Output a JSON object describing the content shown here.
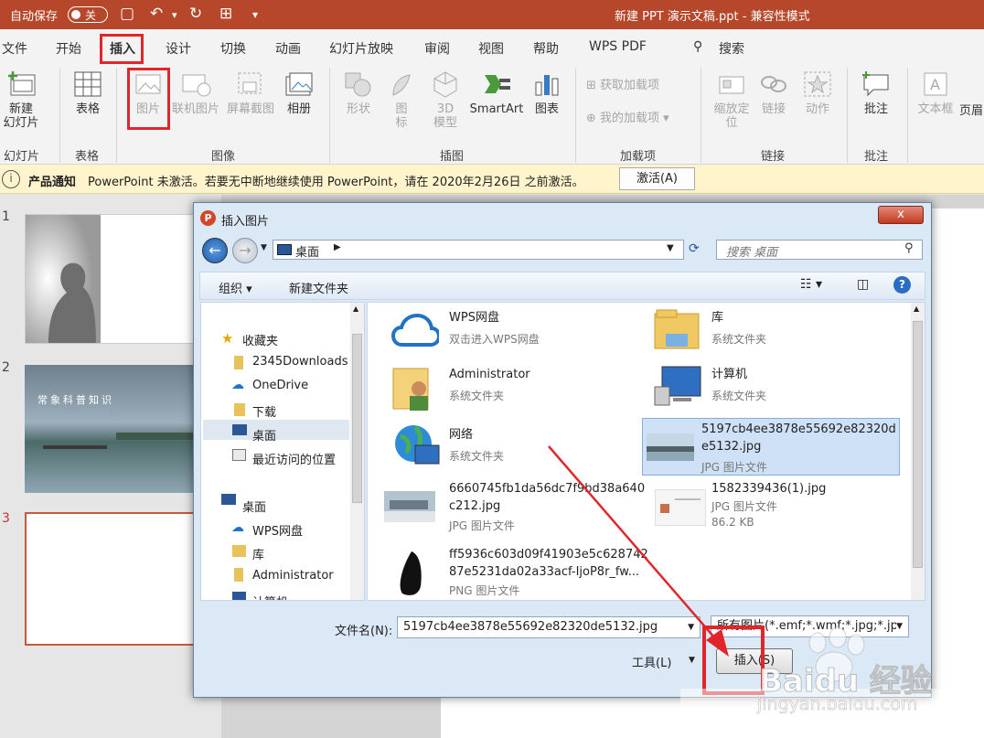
{
  "titlebar": {
    "autosave": "自动保存",
    "toggle": "关",
    "doc_title": "新建 PPT 演示文稿.ppt  -  兼容性模式"
  },
  "tabs": [
    "文件",
    "开始",
    "插入",
    "设计",
    "切换",
    "动画",
    "幻灯片放映",
    "审阅",
    "视图",
    "帮助",
    "WPS PDF",
    "搜索"
  ],
  "ribbon": {
    "new_slide": "新建\n幻灯片",
    "table": "表格",
    "picture": "图片",
    "online_picture": "联机图片",
    "screenshot": "屏幕截图",
    "album": "相册",
    "shapes": "形状",
    "icons": "图\n标",
    "model3d": "3D\n模型",
    "smartart": "SmartArt",
    "chart": "图表",
    "get_addins": "获取加载项",
    "my_addins": "我的加载项",
    "zoom": "缩放定\n位",
    "link": "链接",
    "action": "动作",
    "comment": "批注",
    "textbox": "文本框",
    "header": "页眉",
    "groups": {
      "slides": "幻灯片",
      "tables": "表格",
      "images": "图像",
      "illustrations": "插图",
      "addins": "加载项",
      "links": "链接",
      "comments": "批注"
    }
  },
  "notification": {
    "title": "产品通知",
    "message": "PowerPoint 未激活。若要无中断地继续使用 PowerPoint，请在 2020年2月26日 之前激活。",
    "button": "激活(A)"
  },
  "slides": [
    "1",
    "2",
    "3"
  ],
  "slide2_caption": "常象科普知识",
  "dialog": {
    "title": "插入图片",
    "close": "x",
    "address": "桌面",
    "search_placeholder": "搜索 桌面",
    "organize": "组织 ▾",
    "new_folder": "新建文件夹",
    "nav": {
      "favorites": "收藏夹",
      "items": [
        "2345Downloads",
        "OneDrive",
        "下载",
        "桌面",
        "最近访问的位置"
      ],
      "desktop": "桌面",
      "desktop_items": [
        "WPS网盘",
        "库",
        "Administrator",
        "计算机"
      ]
    },
    "files": [
      {
        "name": "WPS网盘",
        "type": "双击进入WPS网盘"
      },
      {
        "name": "库",
        "type": "系统文件夹"
      },
      {
        "name": "Administrator",
        "type": "系统文件夹"
      },
      {
        "name": "计算机",
        "type": "系统文件夹"
      },
      {
        "name": "网络",
        "type": "系统文件夹"
      },
      {
        "name": "5197cb4ee3878e55692e82320d\ne5132.jpg",
        "type": "JPG 图片文件"
      },
      {
        "name": "6660745fb1da56dc7f9bd38a640\nc212.jpg",
        "type": "JPG 图片文件"
      },
      {
        "name": "1582339436(1).jpg",
        "type": "JPG 图片文件",
        "size": "86.2 KB"
      },
      {
        "name": "ff5936c603d09f41903e5c628742\n87e5231da02a33acf-IjoP8r_fw...",
        "type": "PNG 图片文件"
      }
    ],
    "filename_label": "文件名(N):",
    "filename": "5197cb4ee3878e55692e82320de5132.jpg",
    "filter": "所有图片(*.emf;*.wmf;*.jpg;*.jp",
    "tools": "工具(L)",
    "insert": "插入(S)"
  },
  "watermark": {
    "brand": "Baidu 经验",
    "url": "jingyan.baidu.com"
  }
}
